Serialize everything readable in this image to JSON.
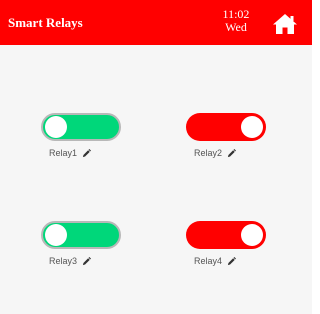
{
  "header": {
    "title": "Smart Relays",
    "time": "11:02",
    "day": "Wed",
    "home_icon": "home-icon",
    "color": "#ff0000"
  },
  "relays": [
    {
      "label": "Relay1",
      "state": "on",
      "color": "#00d77a",
      "edit_icon": "pencil-icon"
    },
    {
      "label": "Relay2",
      "state": "off",
      "color": "#ff0000",
      "edit_icon": "pencil-icon"
    },
    {
      "label": "Relay3",
      "state": "on",
      "color": "#00d77a",
      "edit_icon": "pencil-icon"
    },
    {
      "label": "Relay4",
      "state": "off",
      "color": "#ff0000",
      "edit_icon": "pencil-icon"
    }
  ]
}
